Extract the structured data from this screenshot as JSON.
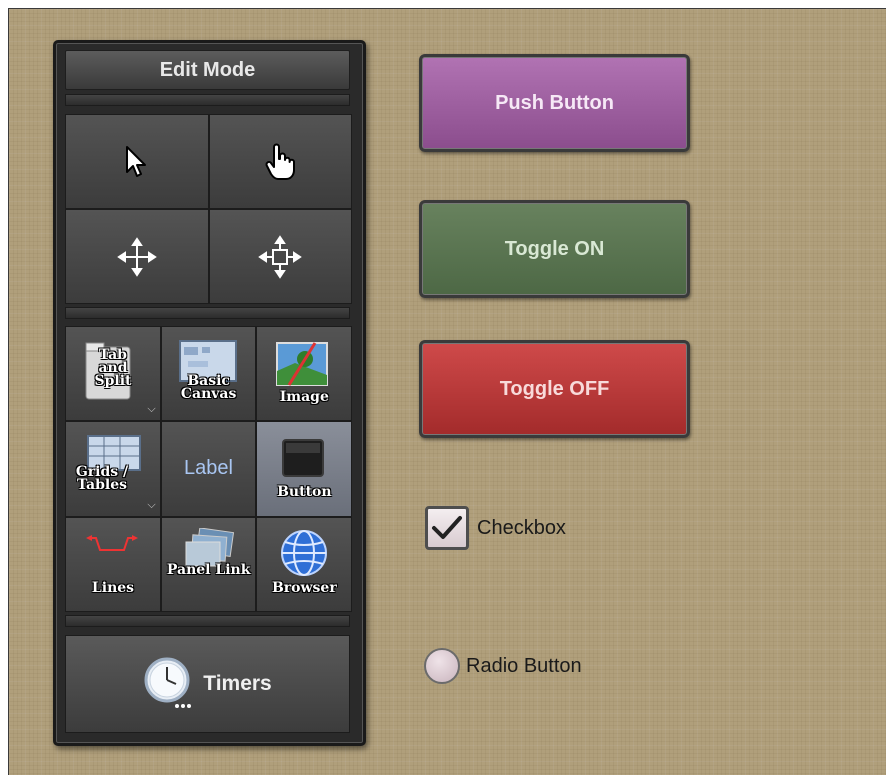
{
  "toolbox": {
    "title": "Edit Mode",
    "cursor_tools": [
      {
        "icon": "arrow-cursor-icon"
      },
      {
        "icon": "hand-cursor-icon"
      },
      {
        "icon": "move-icon"
      },
      {
        "icon": "resize-move-icon"
      }
    ],
    "widgets": {
      "tab_split": "Tab and Split",
      "basic_canvas": "Basic Canvas",
      "image": "Image",
      "grids_tables": "Grids / Tables",
      "label": "Label",
      "button": "Button",
      "lines": "Lines",
      "panel_link": "Panel Link",
      "browser": "Browser"
    },
    "timers": "Timers"
  },
  "widgets": {
    "push_button": "Push Button",
    "toggle_on": "Toggle ON",
    "toggle_off": "Toggle OFF",
    "checkbox": "Checkbox",
    "radio_button": "Radio Button"
  },
  "colors": {
    "canvas": "#b09f7b",
    "push": "#9b5f9d",
    "toggle_on": "#5b7651",
    "toggle_off": "#b83a3a"
  }
}
